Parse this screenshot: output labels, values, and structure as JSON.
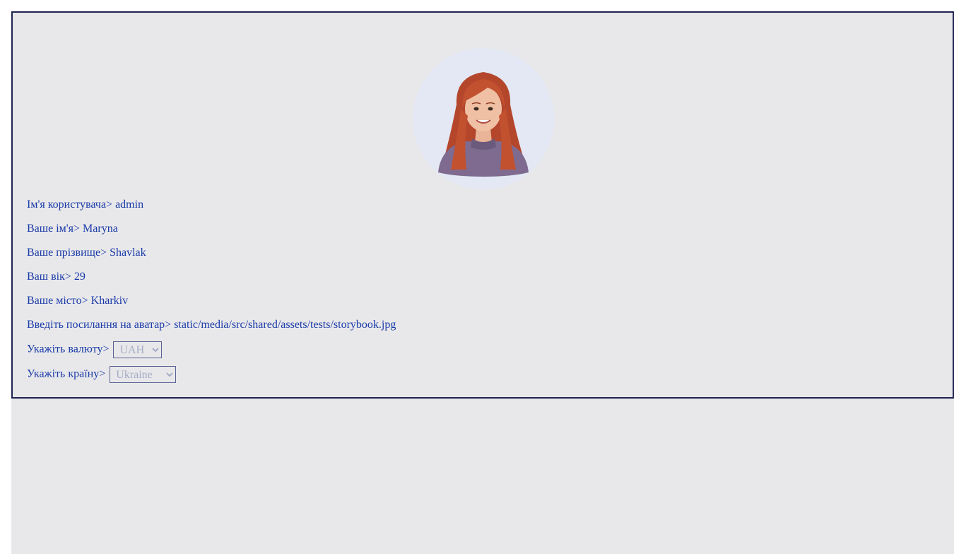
{
  "profile": {
    "avatar": {
      "alt": "avatar",
      "background_color": "#e3e8f4"
    },
    "fields": [
      {
        "label": "Ім'я користувача>",
        "value": " admin"
      },
      {
        "label": "Ваше ім'я>",
        "value": " Maryna"
      },
      {
        "label": "Ваше прізвище>",
        "value": " Shavlak"
      },
      {
        "label": "Ваш вік>",
        "value": " 29"
      },
      {
        "label": "Ваше місто>",
        "value": " Kharkiv"
      },
      {
        "label": "Введіть посилання на аватар>",
        "value": " static/media/src/shared/assets/tests/storybook.jpg"
      }
    ],
    "currency": {
      "label": "Укажіть валюту>",
      "selected": "UAH"
    },
    "country": {
      "label": "Укажіть країну>",
      "selected": "Ukraine"
    }
  },
  "colors": {
    "text": "#1a3aa8",
    "border": "#1e2350",
    "background": "#e8e8ea"
  }
}
